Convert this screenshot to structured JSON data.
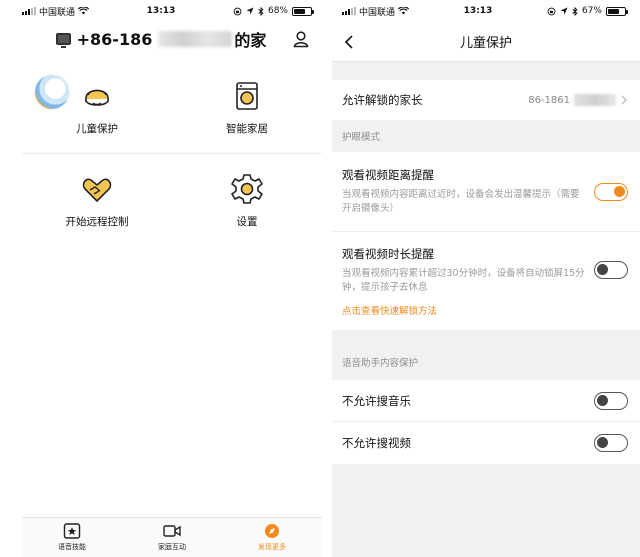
{
  "left": {
    "status": {
      "carrier": "中国联通",
      "time": "13:13",
      "battery": "68%",
      "battery_level": 0.68
    },
    "header": {
      "prefix": "+86-186",
      "suffix": "的家"
    },
    "grid": [
      {
        "label": "儿童保护",
        "icon": "child-head-icon"
      },
      {
        "label": "智能家居",
        "icon": "washing-machine-icon"
      },
      {
        "label": "开始远程控制",
        "icon": "heart-hands-icon"
      },
      {
        "label": "设置",
        "icon": "gear-icon"
      }
    ],
    "tabs": [
      {
        "label": "语音技能",
        "icon": "star-box-icon"
      },
      {
        "label": "家庭互动",
        "icon": "video-camera-icon"
      },
      {
        "label": "发现更多",
        "icon": "compass-icon",
        "active": true
      }
    ],
    "accent": "#f08a1c"
  },
  "right": {
    "status": {
      "carrier": "中国联通",
      "time": "13:13",
      "battery": "67%",
      "battery_level": 0.67
    },
    "nav_title": "儿童保护",
    "parent": {
      "label": "允许解锁的家长",
      "value": "86-1861"
    },
    "eye_section": "护眼模式",
    "distance": {
      "title": "观看视频距离提醒",
      "desc": "当观看视频内容距离过近时，设备会发出温馨提示（需要开启摄像头）",
      "on": true
    },
    "duration": {
      "title": "观看视频时长提醒",
      "desc": "当观看视频内容累计超过30分钟时，设备将自动锁屏15分钟，提示孩子去休息",
      "link": "点击查看快速解锁方法",
      "on": false
    },
    "voice_section": "语音助手内容保护",
    "music": {
      "title": "不允许搜音乐",
      "on": false
    },
    "video": {
      "title": "不允许搜视频",
      "on": false
    }
  }
}
